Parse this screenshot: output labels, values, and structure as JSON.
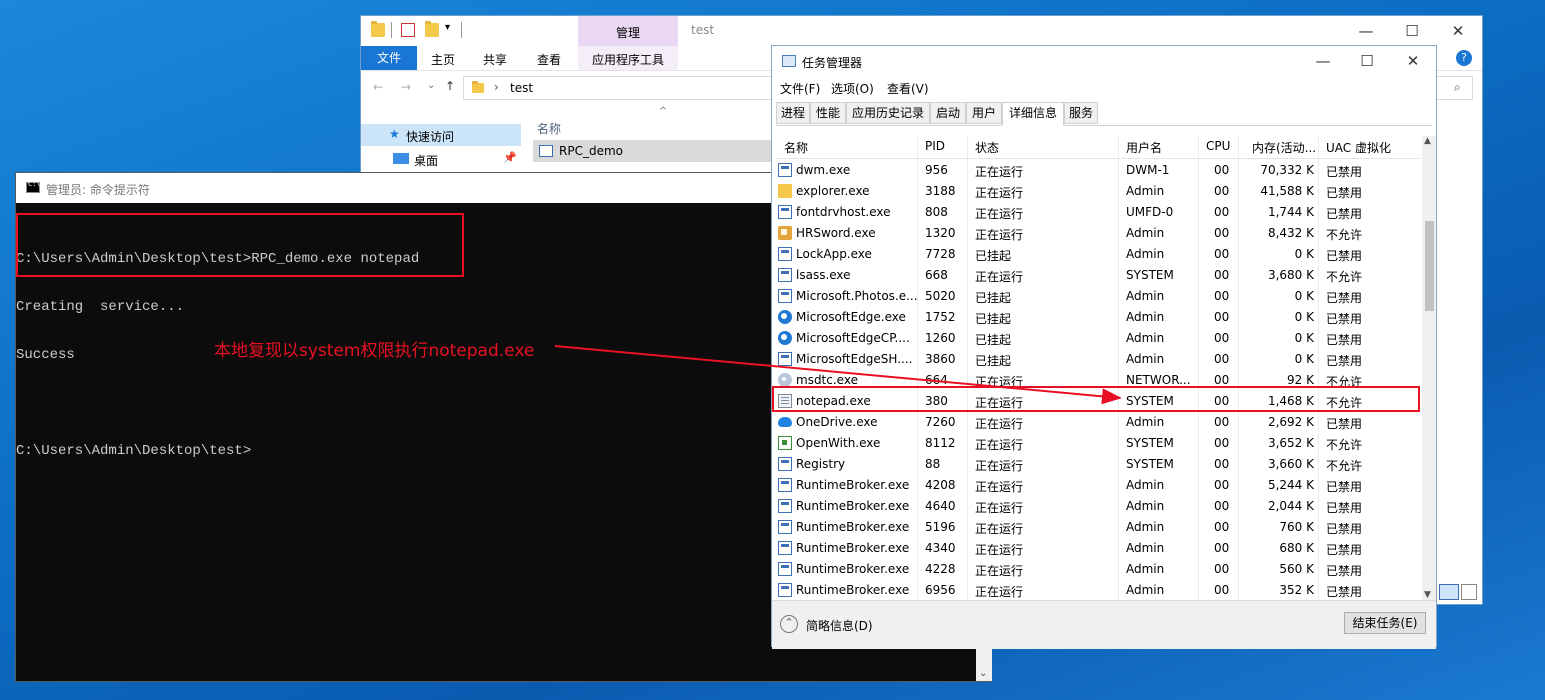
{
  "explorer": {
    "title": "test",
    "manage_tab": "管理",
    "ribbon": {
      "file": "文件",
      "home": "主页",
      "share": "共享",
      "view": "查看",
      "app_tools": "应用程序工具"
    },
    "address_path": "test",
    "nav": {
      "quick_access": "快速访问",
      "desktop": "桌面"
    },
    "column_name": "名称",
    "file": "RPC_demo"
  },
  "cmd": {
    "title": "管理员: 命令提示符",
    "lines": [
      "C:\\Users\\Admin\\Desktop\\test>RPC_demo.exe notepad",
      "Creating  service...",
      "Success",
      "",
      "C:\\Users\\Admin\\Desktop\\test>"
    ]
  },
  "annotation": "本地复现以system权限执行notepad.exe",
  "taskmgr": {
    "title": "任务管理器",
    "menu": [
      "文件(F)",
      "选项(O)",
      "查看(V)"
    ],
    "tabs": [
      "进程",
      "性能",
      "应用历史记录",
      "启动",
      "用户",
      "详细信息",
      "服务"
    ],
    "active_tab": "详细信息",
    "columns": {
      "name": "名称",
      "pid": "PID",
      "status": "状态",
      "user": "用户名",
      "cpu": "CPU",
      "mem": "内存(活动...",
      "uac": "UAC 虚拟化"
    },
    "rows": [
      {
        "icon": "window",
        "name": "dwm.exe",
        "pid": "956",
        "status": "正在运行",
        "user": "DWM-1",
        "cpu": "00",
        "mem": "70,332 K",
        "uac": "已禁用"
      },
      {
        "icon": "folder",
        "name": "explorer.exe",
        "pid": "3188",
        "status": "正在运行",
        "user": "Admin",
        "cpu": "00",
        "mem": "41,588 K",
        "uac": "已禁用"
      },
      {
        "icon": "window",
        "name": "fontdrvhost.exe",
        "pid": "808",
        "status": "正在运行",
        "user": "UMFD-0",
        "cpu": "00",
        "mem": "1,744 K",
        "uac": "已禁用"
      },
      {
        "icon": "hrsword",
        "name": "HRSword.exe",
        "pid": "1320",
        "status": "正在运行",
        "user": "Admin",
        "cpu": "00",
        "mem": "8,432 K",
        "uac": "不允许"
      },
      {
        "icon": "window",
        "name": "LockApp.exe",
        "pid": "7728",
        "status": "已挂起",
        "user": "Admin",
        "cpu": "00",
        "mem": "0 K",
        "uac": "已禁用"
      },
      {
        "icon": "window",
        "name": "lsass.exe",
        "pid": "668",
        "status": "正在运行",
        "user": "SYSTEM",
        "cpu": "00",
        "mem": "3,680 K",
        "uac": "不允许"
      },
      {
        "icon": "window",
        "name": "Microsoft.Photos.e...",
        "pid": "5020",
        "status": "已挂起",
        "user": "Admin",
        "cpu": "00",
        "mem": "0 K",
        "uac": "已禁用"
      },
      {
        "icon": "edge",
        "name": "MicrosoftEdge.exe",
        "pid": "1752",
        "status": "已挂起",
        "user": "Admin",
        "cpu": "00",
        "mem": "0 K",
        "uac": "已禁用"
      },
      {
        "icon": "edge",
        "name": "MicrosoftEdgeCP....",
        "pid": "1260",
        "status": "已挂起",
        "user": "Admin",
        "cpu": "00",
        "mem": "0 K",
        "uac": "已禁用"
      },
      {
        "icon": "window",
        "name": "MicrosoftEdgeSH....",
        "pid": "3860",
        "status": "已挂起",
        "user": "Admin",
        "cpu": "00",
        "mem": "0 K",
        "uac": "已禁用"
      },
      {
        "icon": "service",
        "name": "msdtc.exe",
        "pid": "664",
        "status": "正在运行",
        "user": "NETWOR...",
        "cpu": "00",
        "mem": "92 K",
        "uac": "不允许"
      },
      {
        "icon": "notepad",
        "name": "notepad.exe",
        "pid": "380",
        "status": "正在运行",
        "user": "SYSTEM",
        "cpu": "00",
        "mem": "1,468 K",
        "uac": "不允许"
      },
      {
        "icon": "onedrive",
        "name": "OneDrive.exe",
        "pid": "7260",
        "status": "正在运行",
        "user": "Admin",
        "cpu": "00",
        "mem": "2,692 K",
        "uac": "已禁用"
      },
      {
        "icon": "openwith",
        "name": "OpenWith.exe",
        "pid": "8112",
        "status": "正在运行",
        "user": "SYSTEM",
        "cpu": "00",
        "mem": "3,652 K",
        "uac": "不允许"
      },
      {
        "icon": "window",
        "name": "Registry",
        "pid": "88",
        "status": "正在运行",
        "user": "SYSTEM",
        "cpu": "00",
        "mem": "3,660 K",
        "uac": "不允许"
      },
      {
        "icon": "window",
        "name": "RuntimeBroker.exe",
        "pid": "4208",
        "status": "正在运行",
        "user": "Admin",
        "cpu": "00",
        "mem": "5,244 K",
        "uac": "已禁用"
      },
      {
        "icon": "window",
        "name": "RuntimeBroker.exe",
        "pid": "4640",
        "status": "正在运行",
        "user": "Admin",
        "cpu": "00",
        "mem": "2,044 K",
        "uac": "已禁用"
      },
      {
        "icon": "window",
        "name": "RuntimeBroker.exe",
        "pid": "5196",
        "status": "正在运行",
        "user": "Admin",
        "cpu": "00",
        "mem": "760 K",
        "uac": "已禁用"
      },
      {
        "icon": "window",
        "name": "RuntimeBroker.exe",
        "pid": "4340",
        "status": "正在运行",
        "user": "Admin",
        "cpu": "00",
        "mem": "680 K",
        "uac": "已禁用"
      },
      {
        "icon": "window",
        "name": "RuntimeBroker.exe",
        "pid": "4228",
        "status": "正在运行",
        "user": "Admin",
        "cpu": "00",
        "mem": "560 K",
        "uac": "已禁用"
      },
      {
        "icon": "window",
        "name": "RuntimeBroker.exe",
        "pid": "6956",
        "status": "正在运行",
        "user": "Admin",
        "cpu": "00",
        "mem": "352 K",
        "uac": "已禁用"
      }
    ],
    "fewer_details": "简略信息(D)",
    "end_task": "结束任务(E)"
  }
}
